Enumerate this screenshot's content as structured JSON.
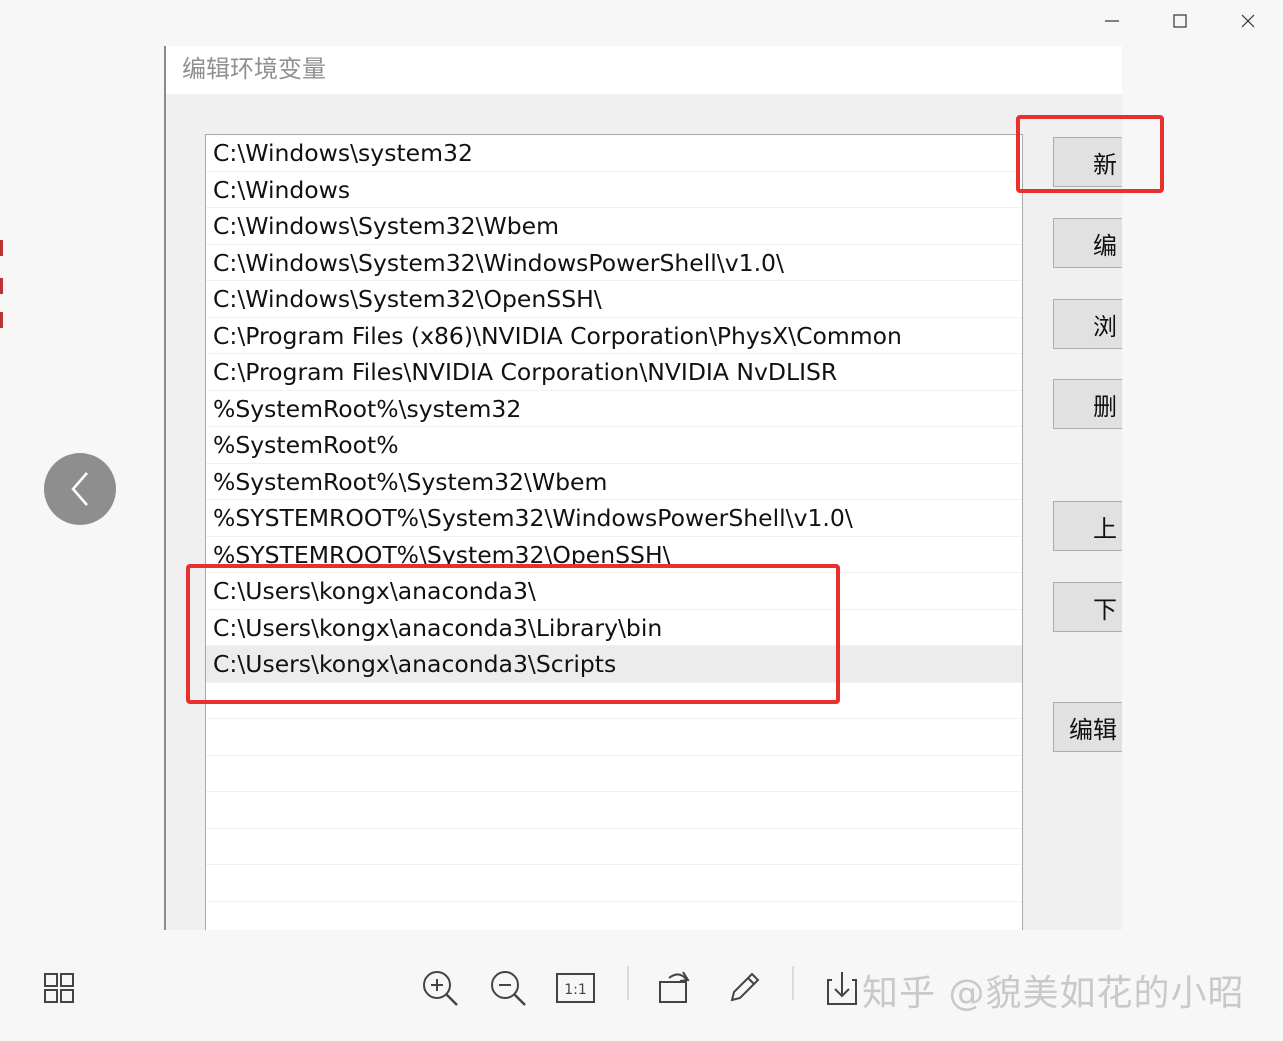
{
  "dialog": {
    "title": "编辑环境变量",
    "paths": [
      "C:\\Windows\\system32",
      "C:\\Windows",
      "C:\\Windows\\System32\\Wbem",
      "C:\\Windows\\System32\\WindowsPowerShell\\v1.0\\",
      "C:\\Windows\\System32\\OpenSSH\\",
      "C:\\Program Files (x86)\\NVIDIA Corporation\\PhysX\\Common",
      "C:\\Program Files\\NVIDIA Corporation\\NVIDIA NvDLISR",
      "%SystemRoot%\\system32",
      "%SystemRoot%",
      "%SystemRoot%\\System32\\Wbem",
      "%SYSTEMROOT%\\System32\\WindowsPowerShell\\v1.0\\",
      "%SYSTEMROOT%\\System32\\OpenSSH\\",
      "C:\\Users\\kongx\\anaconda3\\",
      "C:\\Users\\kongx\\anaconda3\\Library\\bin",
      "C:\\Users\\kongx\\anaconda3\\Scripts",
      "",
      "",
      "",
      "",
      "",
      "",
      ""
    ],
    "selected_index": 14,
    "buttons": {
      "new": "新",
      "edit": "编",
      "browse": "浏",
      "delete": "删",
      "up": "上",
      "down": "下",
      "edit_text": "编辑"
    }
  },
  "viewer": {
    "window_controls": [
      "minimize-icon",
      "maximize-icon",
      "close-icon"
    ],
    "toolbar_icons": [
      "grid-icon",
      "zoom-in-icon",
      "zoom-out-icon",
      "actual-size-icon",
      "rotate-icon",
      "edit-pen-icon",
      "download-icon"
    ],
    "actual_size_label": "1:1",
    "watermark": "知乎 @貌美如花的小昭"
  },
  "colors": {
    "highlight": "#e8302c"
  }
}
